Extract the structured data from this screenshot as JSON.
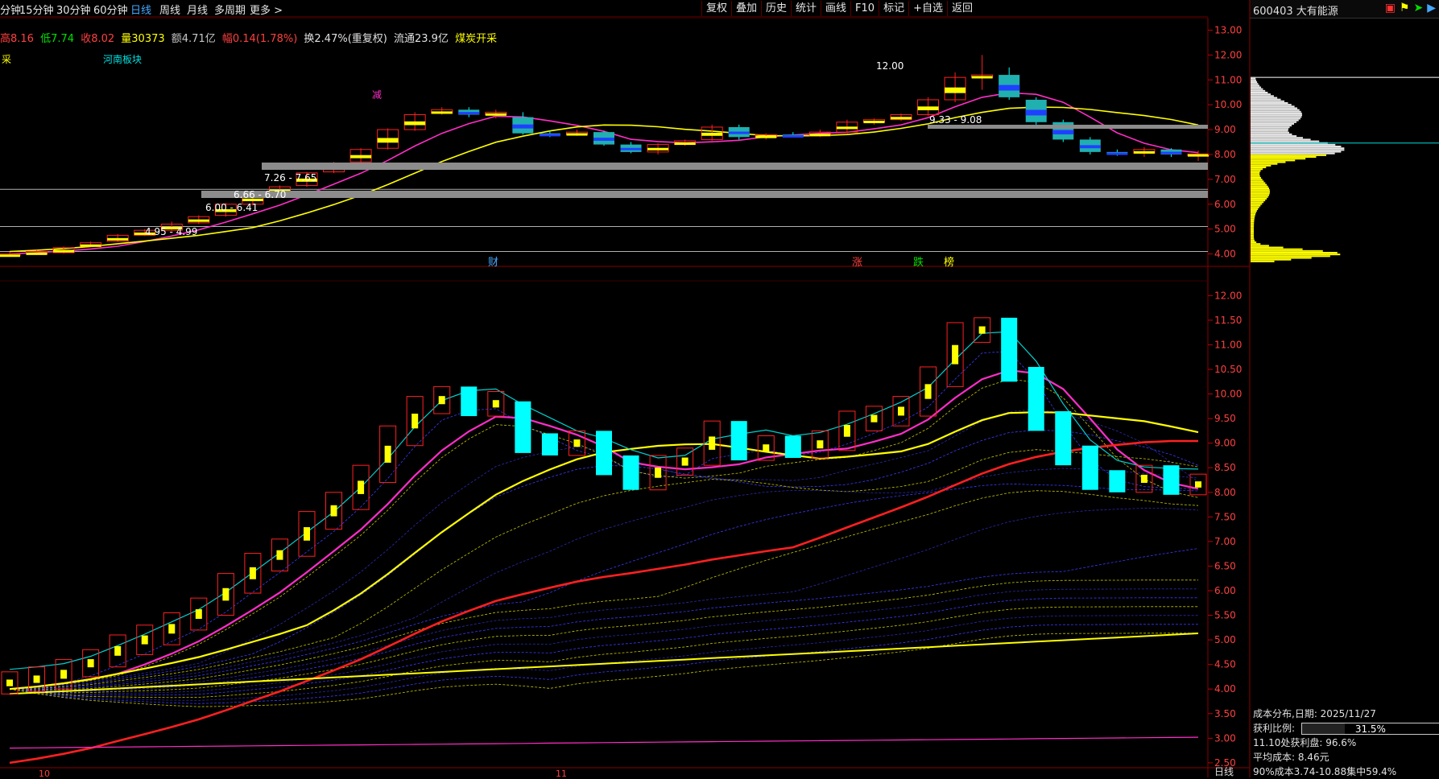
{
  "tabs": [
    {
      "label": "分钟",
      "active": false
    },
    {
      "label": "15分钟",
      "active": false
    },
    {
      "label": "30分钟",
      "active": false
    },
    {
      "label": "60分钟",
      "active": false
    },
    {
      "label": "日线",
      "active": true
    },
    {
      "label": "周线",
      "active": false
    },
    {
      "label": "月线",
      "active": false
    },
    {
      "label": "多周期",
      "active": false
    },
    {
      "label": "更多 >",
      "active": false
    }
  ],
  "toolbar": [
    "复权",
    "叠加",
    "历史",
    "统计",
    "画线",
    "F10",
    "标记",
    "+自选",
    "返回"
  ],
  "stock": {
    "code_name": "600403 大有能源"
  },
  "quote": {
    "high": "高8.16",
    "low": "低7.74",
    "close": "收8.02",
    "volume": "量30373",
    "amount": "额4.71亿",
    "change": "幅0.14(1.78%)",
    "turnover": "换2.47%(重复权)",
    "float": "流通23.9亿",
    "tag": "煤炭开采"
  },
  "labels": {
    "sector": "河南板块",
    "left_tag": "采",
    "events": [
      "财",
      "涨",
      "跌",
      "榜"
    ],
    "sell_mark": "减"
  },
  "main_chart": {
    "y_ticks": [
      13,
      12,
      11,
      10,
      9,
      8,
      7,
      6,
      5,
      4
    ],
    "price_labels": [
      "12.00",
      "9.33 - 9.08",
      "7.26 - 7.65",
      "6.66 - 6.70",
      "6.00 - 6.41",
      "4.95 - 4.99"
    ]
  },
  "sub_chart": {
    "y_ticks": [
      12,
      11.5,
      11,
      10.5,
      10,
      9.5,
      9,
      8.5,
      8,
      7.5,
      7,
      6.5,
      6,
      5.5,
      5,
      4.5,
      4,
      3.5,
      3,
      2.5
    ]
  },
  "x_labels": [
    "10",
    "11"
  ],
  "cost_panel": {
    "title": "成本分布,日期: 2025/11/27",
    "profit_label": "获利比例:",
    "profit_value": "31.5%",
    "profit_ratio": 0.315,
    "line2": "11.10处获利盘: 96.6%",
    "line3": "平均成本: 8.46元",
    "line4": "90%成本3.74-10.88集中59.4%"
  },
  "period_label": "日线",
  "colors": {
    "up": "#ff2020",
    "down": "#00ffff",
    "yellow": "#ffff00",
    "magenta": "#ff2ec8",
    "accent": "#44a8ff"
  },
  "chart_data": {
    "type": "candlestick",
    "candles": [
      [
        3.95,
        4.0,
        4.08,
        3.9
      ],
      [
        4.0,
        4.1,
        4.15,
        3.98
      ],
      [
        4.05,
        4.25,
        4.3,
        4.02
      ],
      [
        4.3,
        4.45,
        4.5,
        4.28
      ],
      [
        4.5,
        4.75,
        4.8,
        4.48
      ],
      [
        4.75,
        4.95,
        5.0,
        4.72
      ],
      [
        4.95,
        5.2,
        5.3,
        4.92
      ],
      [
        5.25,
        5.5,
        5.55,
        5.2
      ],
      [
        5.55,
        6.0,
        6.05,
        5.5
      ],
      [
        6.0,
        6.41,
        6.5,
        5.95
      ],
      [
        6.45,
        6.7,
        6.75,
        6.4
      ],
      [
        6.75,
        7.26,
        7.3,
        6.7
      ],
      [
        7.3,
        7.65,
        7.7,
        7.25
      ],
      [
        7.7,
        8.2,
        8.25,
        7.65
      ],
      [
        8.25,
        9.0,
        9.05,
        8.2
      ],
      [
        9.0,
        9.6,
        9.7,
        8.95
      ],
      [
        9.65,
        9.8,
        9.9,
        9.6
      ],
      [
        9.8,
        9.6,
        9.9,
        9.5
      ],
      [
        9.6,
        9.7,
        9.8,
        9.45
      ],
      [
        9.5,
        8.85,
        9.7,
        8.8
      ],
      [
        8.85,
        8.8,
        8.95,
        8.7
      ],
      [
        8.8,
        8.9,
        9.0,
        8.75
      ],
      [
        8.9,
        8.4,
        8.95,
        8.35
      ],
      [
        8.4,
        8.1,
        8.5,
        8.05
      ],
      [
        8.1,
        8.4,
        8.45,
        8.0
      ],
      [
        8.4,
        8.55,
        8.6,
        8.35
      ],
      [
        8.6,
        9.1,
        9.2,
        8.55
      ],
      [
        9.1,
        8.7,
        9.2,
        8.6
      ],
      [
        8.7,
        8.8,
        8.85,
        8.6
      ],
      [
        8.8,
        8.75,
        8.9,
        8.7
      ],
      [
        8.75,
        8.9,
        9.0,
        8.7
      ],
      [
        8.9,
        9.3,
        9.4,
        8.85
      ],
      [
        9.3,
        9.4,
        9.45,
        9.2
      ],
      [
        9.4,
        9.6,
        9.65,
        9.35
      ],
      [
        9.6,
        10.2,
        10.3,
        9.55
      ],
      [
        10.2,
        11.1,
        11.3,
        10.1
      ],
      [
        11.1,
        11.2,
        12.0,
        10.6
      ],
      [
        11.2,
        10.3,
        11.5,
        10.2
      ],
      [
        10.2,
        9.3,
        10.3,
        9.2
      ],
      [
        9.3,
        8.6,
        9.4,
        8.5
      ],
      [
        8.6,
        8.1,
        8.7,
        8.0
      ],
      [
        8.1,
        8.05,
        8.2,
        7.95
      ],
      [
        8.05,
        8.2,
        8.3,
        7.9
      ],
      [
        8.2,
        8.0,
        8.25,
        7.9
      ],
      [
        8.0,
        8.02,
        8.16,
        7.74
      ]
    ],
    "y_range_main": [
      3.5,
      13.5
    ],
    "y_range_sub": [
      2.4,
      12.3
    ]
  }
}
